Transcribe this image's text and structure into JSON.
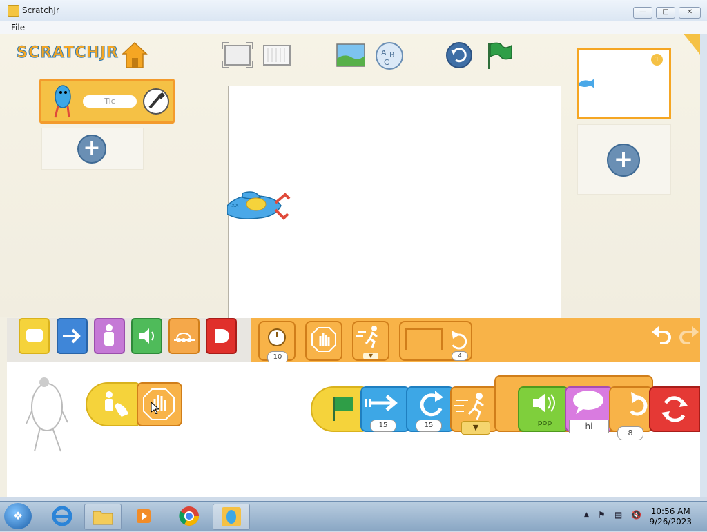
{
  "window": {
    "title": "ScratchJr",
    "minimize_icon": "minimize-icon",
    "maximize_icon": "maximize-icon",
    "close_icon": "close-icon"
  },
  "menu": {
    "file_label": "File"
  },
  "app": {
    "logo_text": "SCRATCHJR",
    "sprite": {
      "name": "Tic"
    },
    "page_number": "1",
    "palette": {
      "wait_value": "10",
      "repeat_value": "4"
    },
    "script": {
      "move_steps": "15",
      "turn_steps": "15",
      "sound_label": "pop",
      "say_text": "hi",
      "repeat_count": "8"
    }
  },
  "taskbar": {
    "time": "10:56 AM",
    "date": "9/26/2023"
  },
  "colors": {
    "accent_orange": "#f8b348",
    "trigger_yellow": "#f5d33b",
    "motion_blue": "#3da7e6",
    "looks_purple": "#c579d6",
    "sound_green": "#5bc35b",
    "control_orange": "#f39b2c",
    "end_red": "#e53935"
  }
}
